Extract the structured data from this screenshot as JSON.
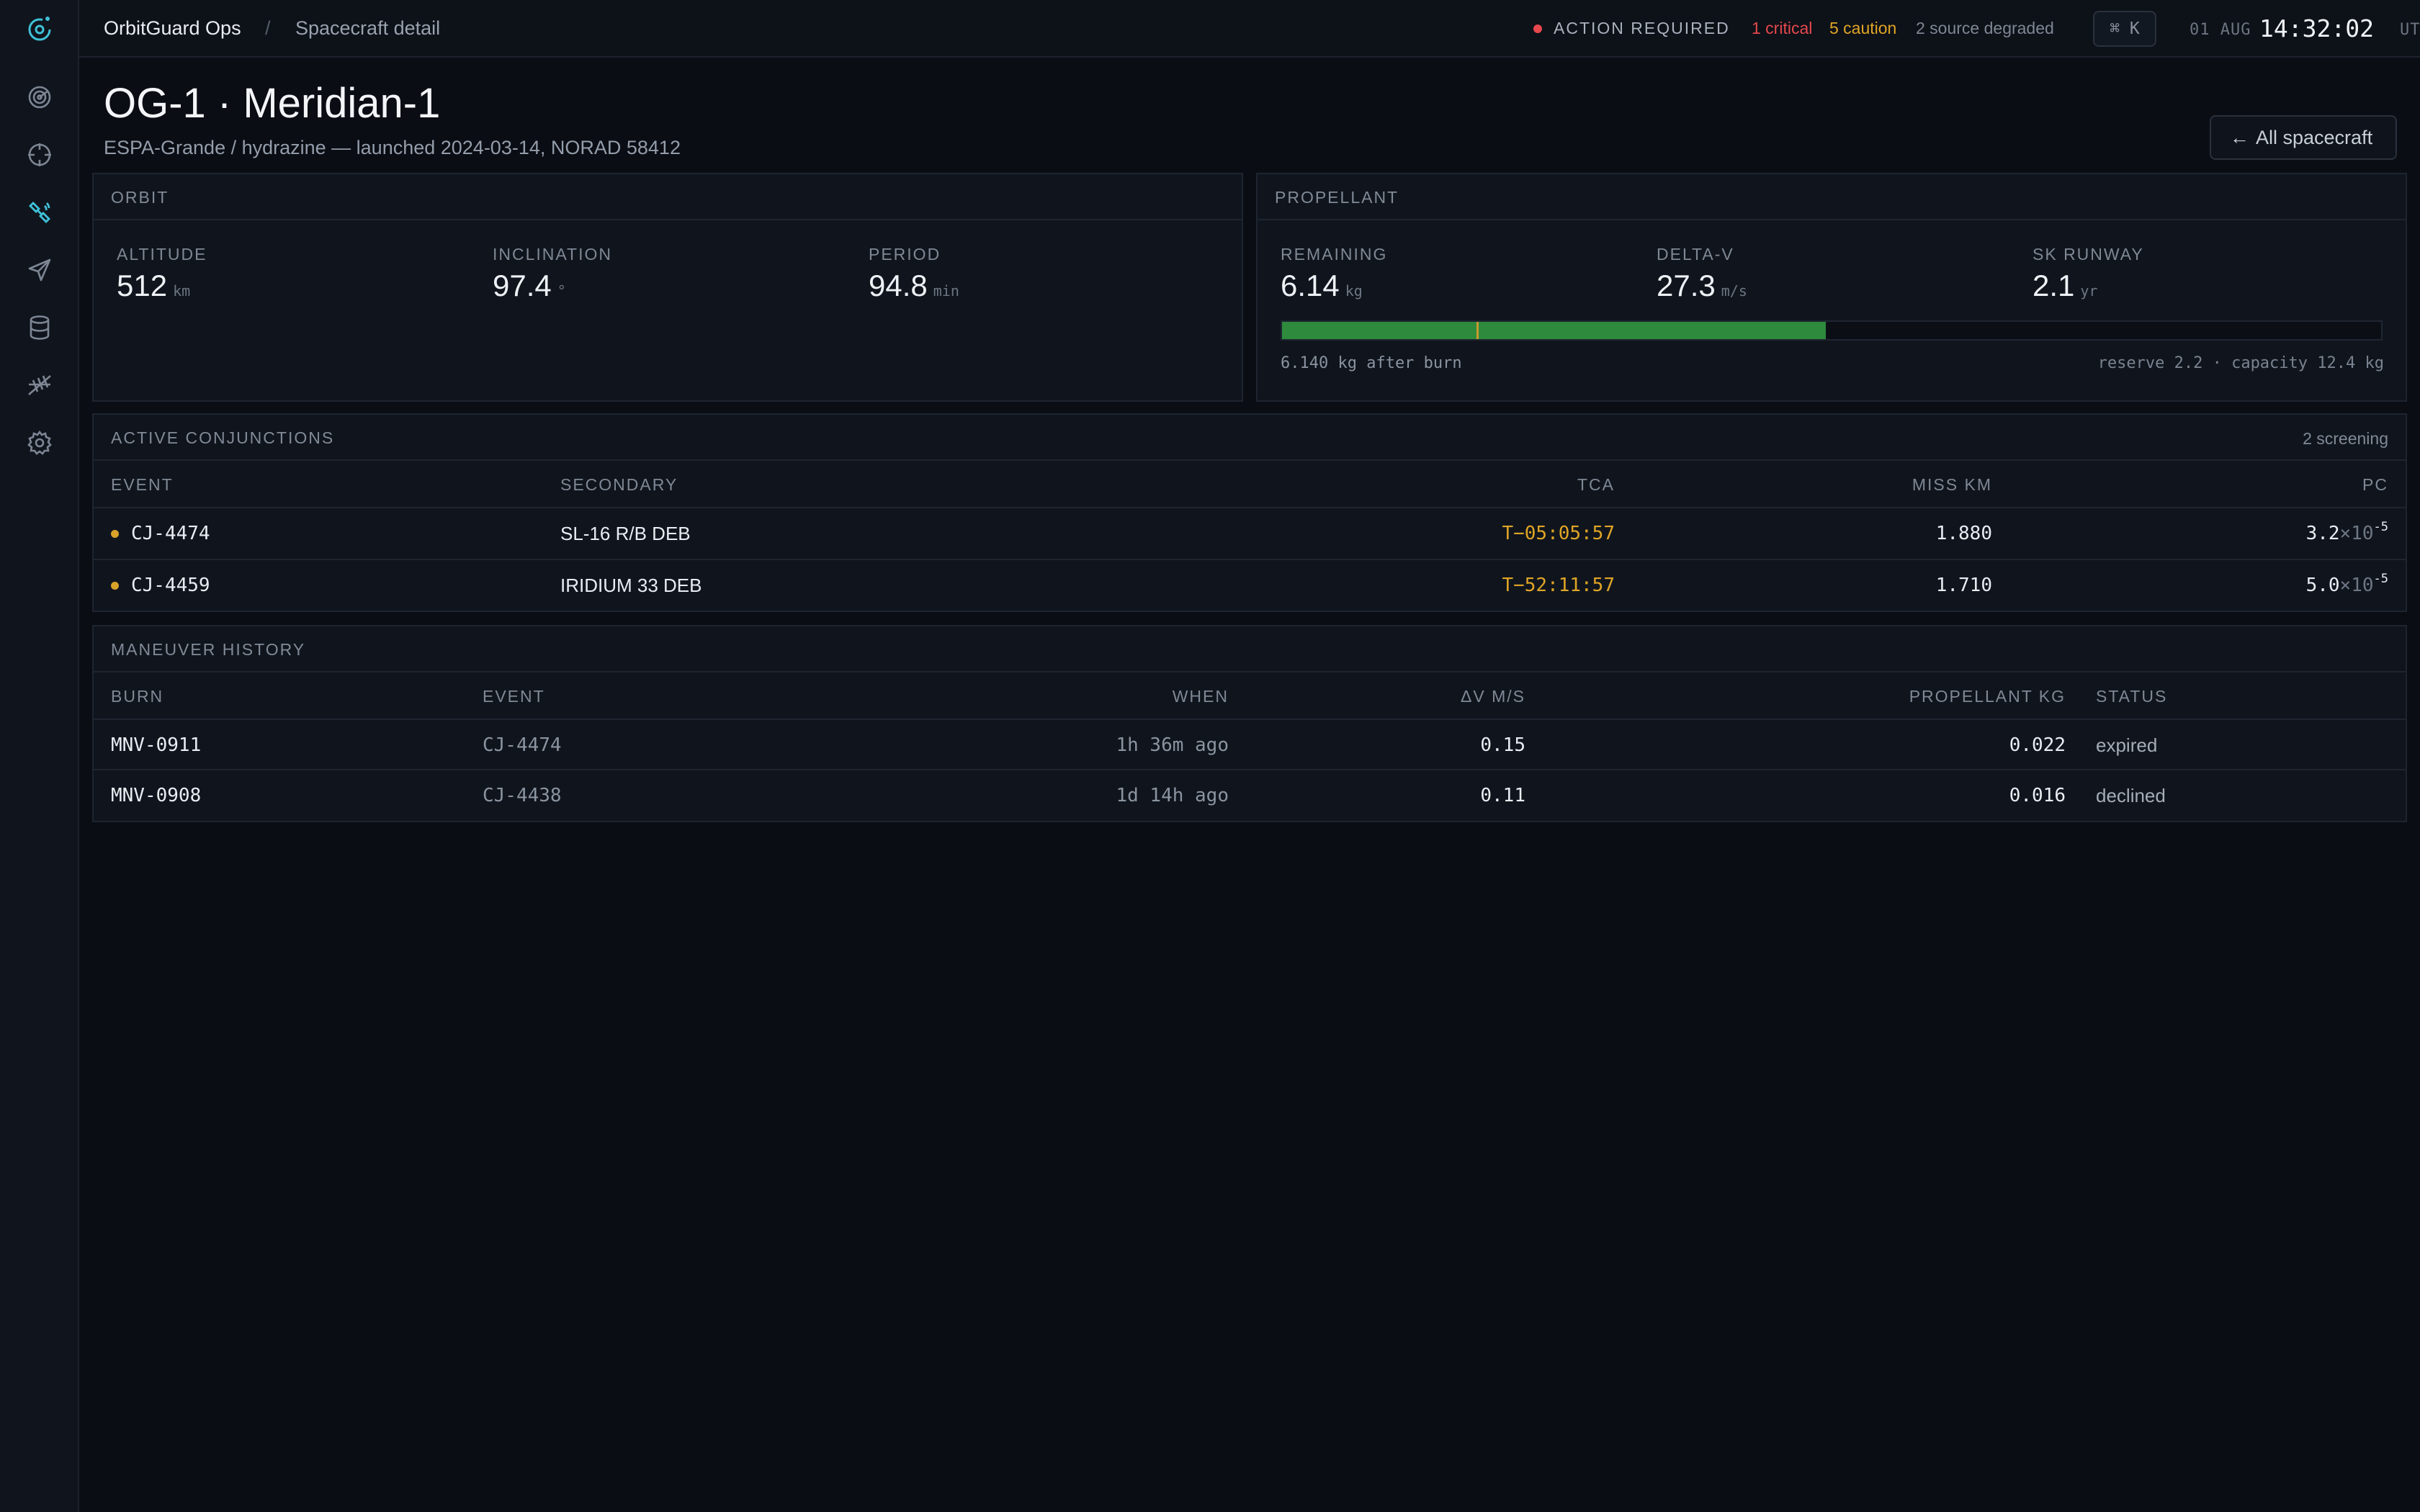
{
  "colors": {
    "accent": "#3fc1d9",
    "critical": "#e5484d",
    "caution": "#e0a526",
    "good": "#2e8a3c",
    "background": "#0a0d13"
  },
  "sidebar": {
    "logo_icon": "orbit-logo-icon",
    "items": [
      {
        "name": "radar-icon",
        "active": false
      },
      {
        "name": "crosshair-icon",
        "active": false
      },
      {
        "name": "satellite-icon",
        "active": true
      },
      {
        "name": "send-icon",
        "active": false
      },
      {
        "name": "database-icon",
        "active": false
      },
      {
        "name": "antenna-icon",
        "active": false
      },
      {
        "name": "gear-icon",
        "active": false
      }
    ]
  },
  "topbar": {
    "app_name": "OrbitGuard Ops",
    "separator": "/",
    "page_name": "Spacecraft detail",
    "alert_label": "ACTION REQUIRED",
    "critical_count": "1 critical",
    "caution_count": "5 caution",
    "degraded_count": "2 source degraded",
    "shortcut": "⌘ K",
    "clock": {
      "date": "01 AUG",
      "time": "14:32:02",
      "tz": "UTC"
    }
  },
  "header": {
    "title": "OG-1 · Meridian-1",
    "subtitle": "ESPA-Grande / hydrazine — launched 2024-03-14, NORAD 58412",
    "back_label": "All spacecraft"
  },
  "orbit": {
    "title": "ORBIT",
    "stats": [
      {
        "label": "ALTITUDE",
        "value": "512",
        "unit": "km"
      },
      {
        "label": "INCLINATION",
        "value": "97.4",
        "unit": "°"
      },
      {
        "label": "PERIOD",
        "value": "94.8",
        "unit": "min"
      }
    ]
  },
  "propellant": {
    "title": "PROPELLANT",
    "stats": [
      {
        "label": "REMAINING",
        "value": "6.14",
        "unit": "kg"
      },
      {
        "label": "DELTA-V",
        "value": "27.3",
        "unit": "m/s"
      },
      {
        "label": "SK RUNWAY",
        "value": "2.1",
        "unit": "yr"
      }
    ],
    "fill_fraction": 0.495,
    "reserve_fraction": 0.177,
    "note": "6.140 kg after burn",
    "capacity_text": "reserve 2.2 · capacity 12.4 kg"
  },
  "conjunctions": {
    "title": "ACTIVE CONJUNCTIONS",
    "meta": "2 screening",
    "columns": [
      "EVENT",
      "SECONDARY",
      "TCA",
      "MISS KM",
      "PC"
    ],
    "rows": [
      {
        "event": "CJ-4474",
        "secondary": "SL-16 R/B DEB",
        "tca": "T−05:05:57",
        "miss": "1.880",
        "pc_mantissa": "3.2",
        "pc_base": "×10",
        "pc_exp": "-5"
      },
      {
        "event": "CJ-4459",
        "secondary": "IRIDIUM 33 DEB",
        "tca": "T−52:11:57",
        "miss": "1.710",
        "pc_mantissa": "5.0",
        "pc_base": "×10",
        "pc_exp": "-5"
      }
    ]
  },
  "maneuvers": {
    "title": "MANEUVER HISTORY",
    "columns": [
      "BURN",
      "EVENT",
      "WHEN",
      "ΔV M/S",
      "PROPELLANT KG",
      "STATUS"
    ],
    "rows": [
      {
        "burn": "MNV-0911",
        "event": "CJ-4474",
        "when": "1h 36m ago",
        "dv": "0.15",
        "prop": "0.022",
        "status": "expired"
      },
      {
        "burn": "MNV-0908",
        "event": "CJ-4438",
        "when": "1d 14h ago",
        "dv": "0.11",
        "prop": "0.016",
        "status": "declined"
      }
    ]
  }
}
